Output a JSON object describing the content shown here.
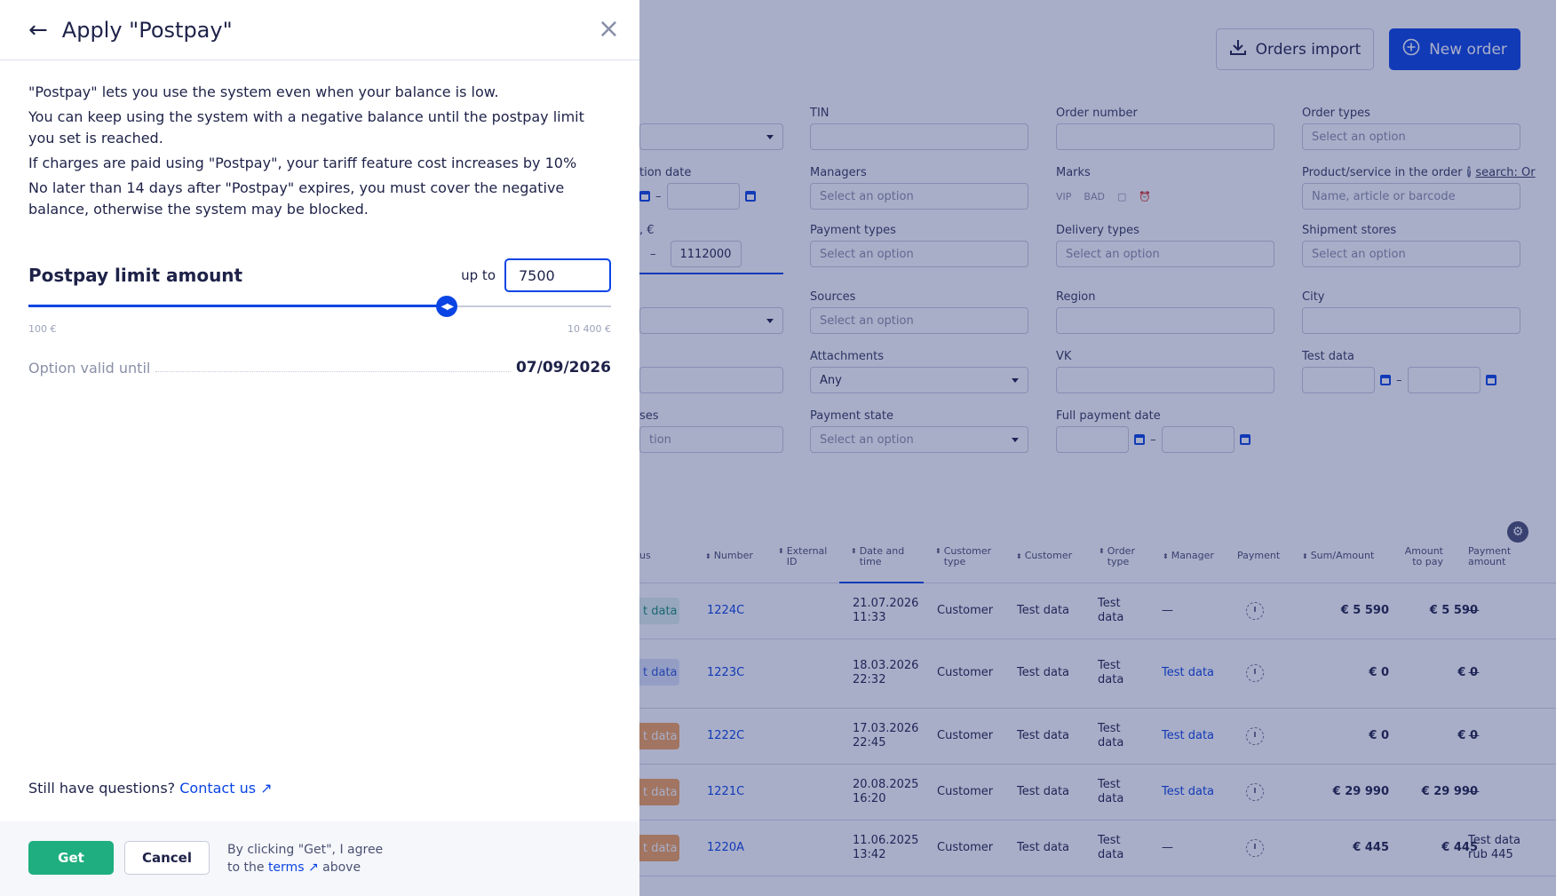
{
  "toolbar": {
    "orders_import_label": "Orders import",
    "new_order_label": "New order"
  },
  "filters": {
    "tin": {
      "label": "TIN",
      "value": ""
    },
    "order_number": {
      "label": "Order number",
      "value": ""
    },
    "order_types": {
      "label": "Order types",
      "placeholder": "Select an option"
    },
    "creation_date": {
      "label": "tion date"
    },
    "managers": {
      "label": "Managers",
      "placeholder": "Select an option"
    },
    "marks": {
      "label": "Marks",
      "items": [
        "VIP",
        "BAD"
      ]
    },
    "product": {
      "label": "Product/service in the order",
      "search_label": "search: Or",
      "placeholder": "Name, article or barcode"
    },
    "sum": {
      "label": ", €",
      "to_value": "1112000"
    },
    "payment_types": {
      "label": "Payment types",
      "placeholder": "Select an option"
    },
    "delivery_types": {
      "label": "Delivery types",
      "placeholder": "Select an option"
    },
    "shipment_stores": {
      "label": "Shipment stores",
      "placeholder": "Select an option"
    },
    "sources": {
      "label": "Sources",
      "placeholder": "Select an option"
    },
    "region": {
      "label": "Region"
    },
    "city": {
      "label": "City"
    },
    "attachments": {
      "label": "Attachments",
      "value": "Any"
    },
    "vk": {
      "label": "VK"
    },
    "test_data": {
      "label": "Test data"
    },
    "statuses": {
      "label": "ses",
      "placeholder": "tion"
    },
    "payment_state": {
      "label": "Payment state",
      "placeholder": "Select an option"
    },
    "full_payment_date": {
      "label": "Full payment date"
    }
  },
  "table": {
    "headers": {
      "status": "us",
      "number": "Number",
      "external_id": "External ID",
      "date_time": "Date and time",
      "customer_type": "Customer type",
      "customer": "Customer",
      "order_type": "Order type",
      "manager": "Manager",
      "payment": "Payment",
      "sum_amount": "Sum/Amount",
      "amount_to_pay": "Amount to pay",
      "payment_amount": "Payment amount"
    },
    "rows": [
      {
        "status": "t data",
        "number": "1224C",
        "date": "21.07.2026",
        "time": "11:33",
        "customer_type": "Customer",
        "customer": "Test data",
        "order_type": "Test data",
        "manager": "—",
        "sum": "€ 5 590",
        "to_pay": "€ 5 590",
        "payment_amount": "—"
      },
      {
        "status": "t data",
        "number": "1223C",
        "date": "18.03.2026",
        "time": "22:32",
        "customer_type": "Customer",
        "customer": "Test data",
        "order_type": "Test data",
        "manager": "Test data",
        "sum": "€ 0",
        "to_pay": "€ 0",
        "payment_amount": "—"
      },
      {
        "status": "t data",
        "number": "1222C",
        "date": "17.03.2026",
        "time": "22:45",
        "customer_type": "Customer",
        "customer": "Test data",
        "order_type": "Test data",
        "manager": "Test data",
        "sum": "€ 0",
        "to_pay": "€ 0",
        "payment_amount": "—"
      },
      {
        "status": "t data",
        "number": "1221C",
        "date": "20.08.2025",
        "time": "16:20",
        "customer_type": "Customer",
        "customer": "Test data",
        "order_type": "Test data",
        "manager": "Test data",
        "sum": "€ 29 990",
        "to_pay": "€ 29 990",
        "payment_amount": "—"
      },
      {
        "status": "t data",
        "number": "1220A",
        "date": "11.06.2025",
        "time": "13:42",
        "customer_type": "Customer",
        "customer": "Test data",
        "order_type": "Test data",
        "manager": "—",
        "sum": "€ 445",
        "to_pay": "€ 445",
        "payment_amount": "Test data rub 445"
      }
    ]
  },
  "panel": {
    "title": "Apply \"Postpay\"",
    "description": [
      "\"Postpay\" lets you use the system even when your balance is low.",
      "You can keep using the system with a negative balance until the postpay limit you set is reached.",
      "If charges are paid using \"Postpay\", your tariff feature cost increases by 10%",
      "No later than 14 days after \"Postpay\" expires, you must cover the negative balance, otherwise the system may be blocked."
    ],
    "limit_title": "Postpay limit amount",
    "upto_label": "up to",
    "limit_value": "7500",
    "slider": {
      "min": 100,
      "max": 10400,
      "value": 7500,
      "min_label": "100 €",
      "max_label": "10 400 €"
    },
    "valid_label": "Option valid until",
    "valid_date": "07/09/2026",
    "questions_text": "Still have questions?",
    "contact_label": "Contact us",
    "get_label": "Get",
    "cancel_label": "Cancel",
    "agree_text_1": "By clicking \"Get\", I agree",
    "agree_text_2": "to the",
    "terms_label": "terms",
    "agree_text_3": "above"
  },
  "colors": {
    "accent": "#0a44e4",
    "success": "#1fae7f",
    "overlay": "#1e2a6e"
  }
}
